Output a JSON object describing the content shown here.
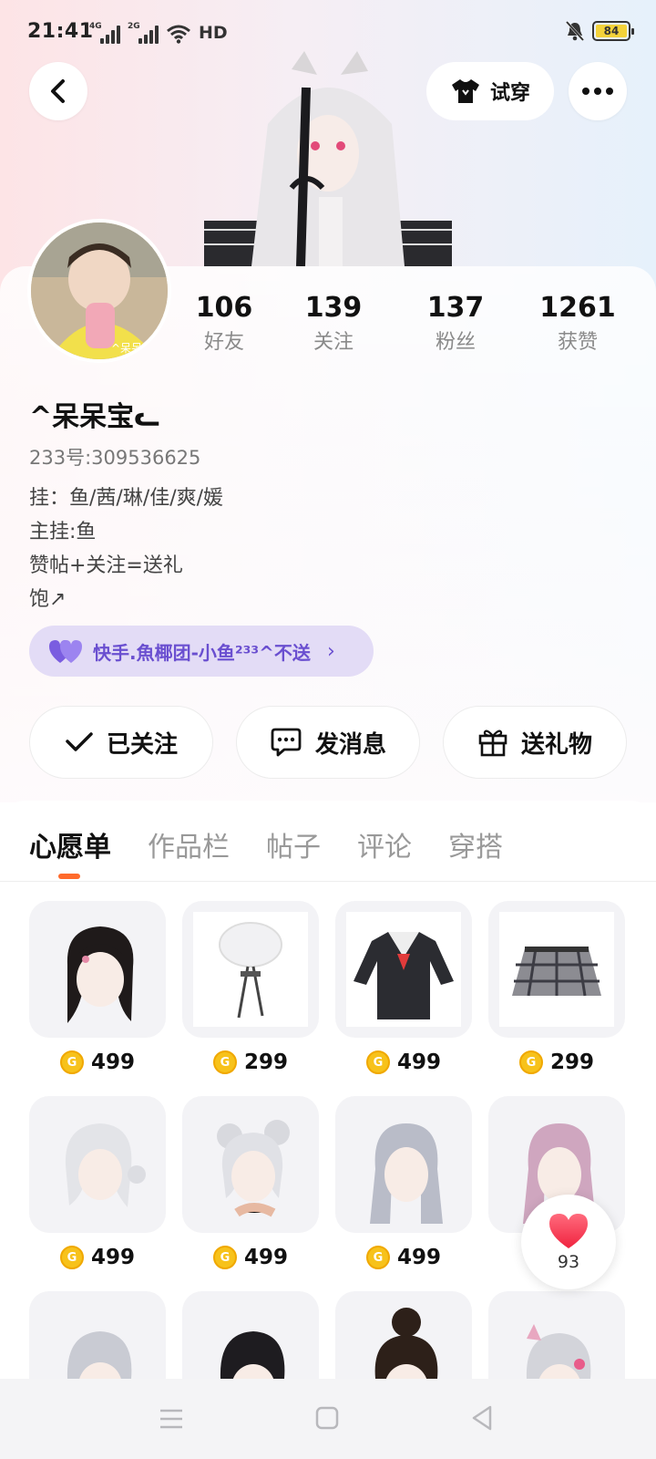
{
  "status_bar": {
    "time": "21:41",
    "network": "HD",
    "battery": "84"
  },
  "header": {
    "tryon_label": "试穿"
  },
  "stats": [
    {
      "value": "106",
      "label": "好友"
    },
    {
      "value": "139",
      "label": "关注"
    },
    {
      "value": "137",
      "label": "粉丝"
    },
    {
      "value": "1261",
      "label": "获赞"
    }
  ],
  "profile": {
    "name": "^呆呆宝ᓚ",
    "id": "233号:309536625",
    "bio": [
      "挂：鱼/茜/琳/佳/爽/媛",
      "主挂:鱼",
      "赞帖+关注=送礼",
      "饱↗"
    ],
    "group": "快手.魚椰团-小鱼²³³^不送",
    "avatar_label": "^呆呆"
  },
  "actions": {
    "follow": "已关注",
    "message": "发消息",
    "gift": "送礼物"
  },
  "tabs": [
    "心愿单",
    "作品栏",
    "帖子",
    "评论",
    "穿搭"
  ],
  "wishlist": [
    {
      "price": "499",
      "icon": "black-hair-item"
    },
    {
      "price": "299",
      "icon": "white-beret-item"
    },
    {
      "price": "499",
      "icon": "sailor-jacket-item"
    },
    {
      "price": "299",
      "icon": "plaid-skirt-item"
    },
    {
      "price": "499",
      "icon": "silver-hair-bun-item"
    },
    {
      "price": "499",
      "icon": "silver-space-buns-item"
    },
    {
      "price": "499",
      "icon": "long-silver-hair-item"
    },
    {
      "price": "",
      "icon": "pink-hair-item"
    },
    {
      "price": "",
      "icon": "silver-hair-item"
    },
    {
      "price": "",
      "icon": "black-hair-item"
    },
    {
      "price": "",
      "icon": "dark-bun-hair-item"
    },
    {
      "price": "",
      "icon": "pink-ribbon-hair-item"
    }
  ],
  "like_fab": {
    "count": "93"
  },
  "colors": {
    "accent": "#ff6a2b",
    "group_text": "#6a4fd0",
    "group_bg": "#e3dcf6",
    "coin": "#f7c21b"
  }
}
